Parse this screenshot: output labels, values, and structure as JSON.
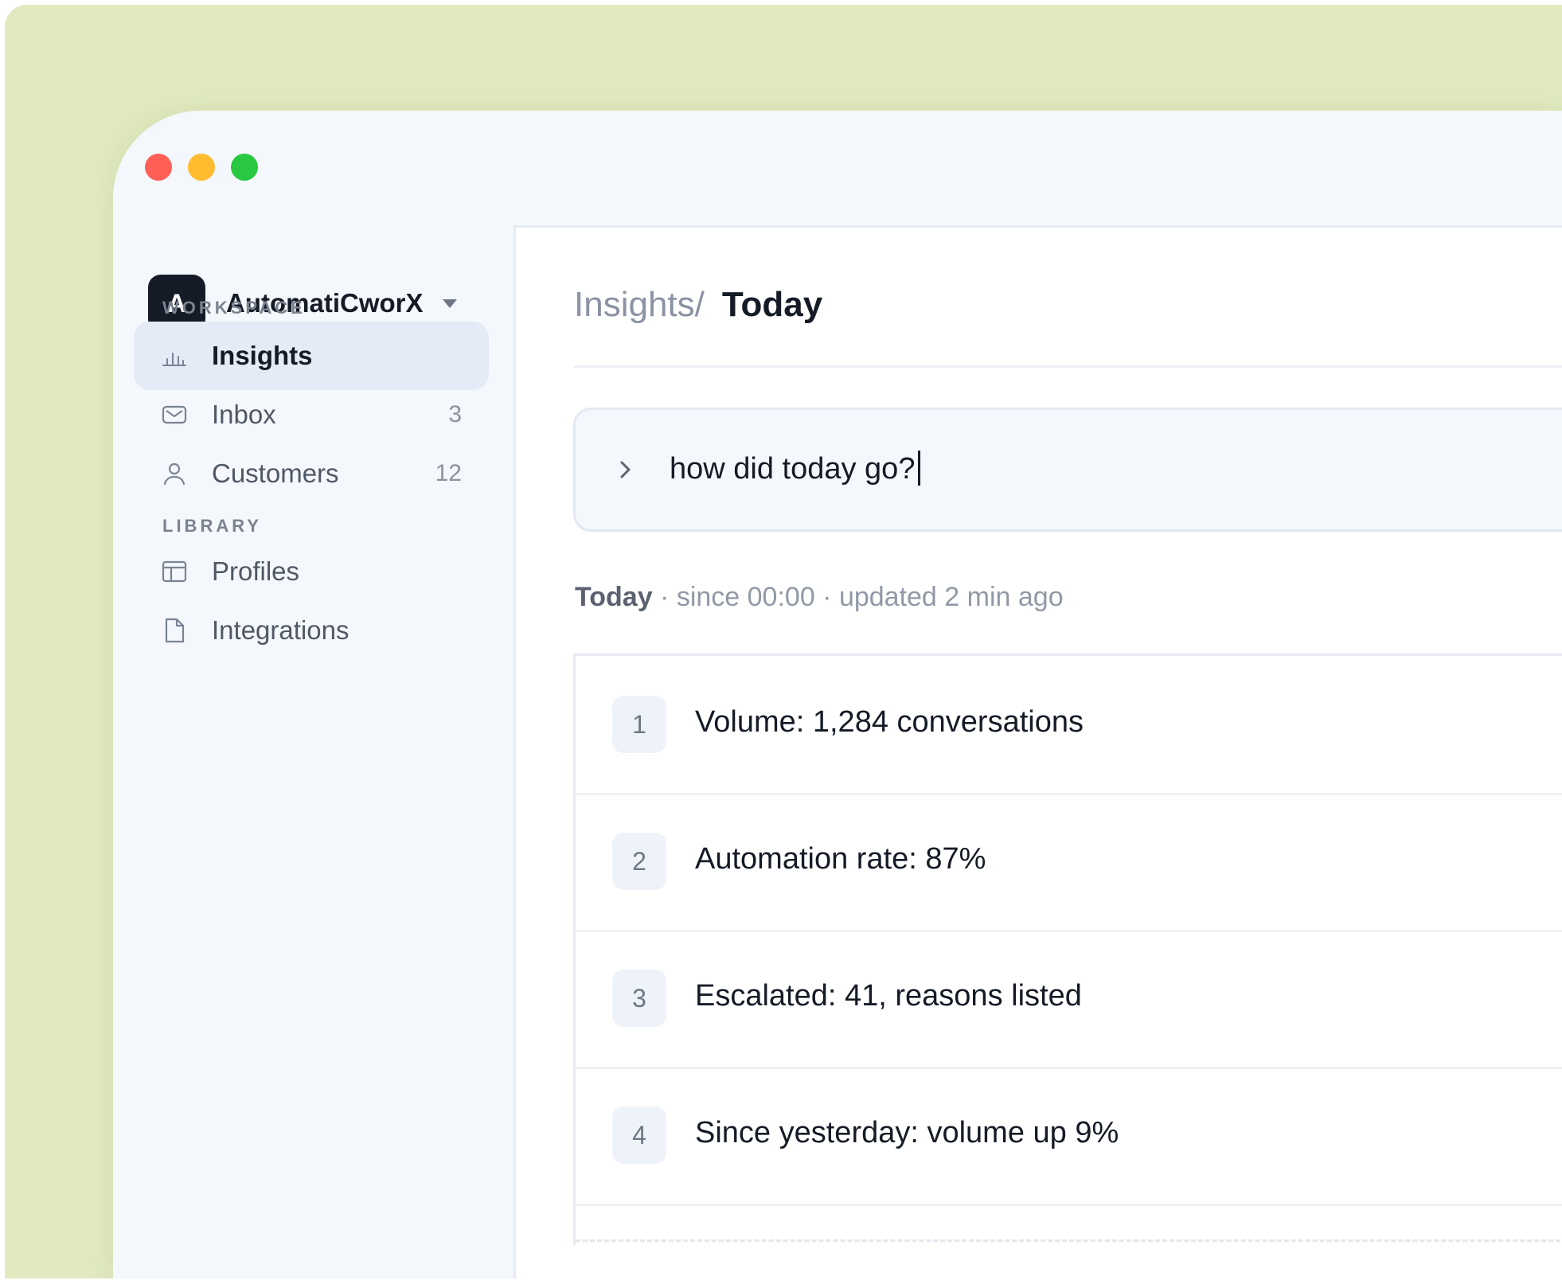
{
  "workspace": {
    "avatar_letter": "A",
    "name": "AutomatiCworX"
  },
  "sidebar": {
    "sections": [
      {
        "label": "WORKSPACE"
      },
      {
        "label": "LIBRARY"
      }
    ],
    "items": [
      {
        "label": "Insights",
        "icon": "bar-chart-icon",
        "active": true,
        "count": ""
      },
      {
        "label": "Inbox",
        "icon": "mail-icon",
        "count": "3"
      },
      {
        "label": "Customers",
        "icon": "user-icon",
        "count": "12"
      },
      {
        "label": "Profiles",
        "icon": "layout-icon",
        "count": ""
      },
      {
        "label": "Integrations",
        "icon": "file-icon",
        "count": ""
      }
    ]
  },
  "breadcrumb": {
    "parent": "Insights/",
    "current": "Today"
  },
  "prompt": {
    "value": "how did today go?"
  },
  "meta": {
    "title": "Today",
    "details": " · since 00:00 · updated 2 min ago"
  },
  "results": [
    {
      "num": "1",
      "text": "Volume: 1,284 conversations"
    },
    {
      "num": "2",
      "text": "Automation rate: 87%"
    },
    {
      "num": "3",
      "text": "Escalated: 41, reasons listed"
    },
    {
      "num": "4",
      "text": "Since yesterday: volume up 9%"
    }
  ],
  "colors": {
    "backdrop": "#e1e9bf",
    "window": "#f4f7fb",
    "ink": "#151b26",
    "muted": "#8a93a2",
    "active_bg": "#e4ebf6"
  }
}
